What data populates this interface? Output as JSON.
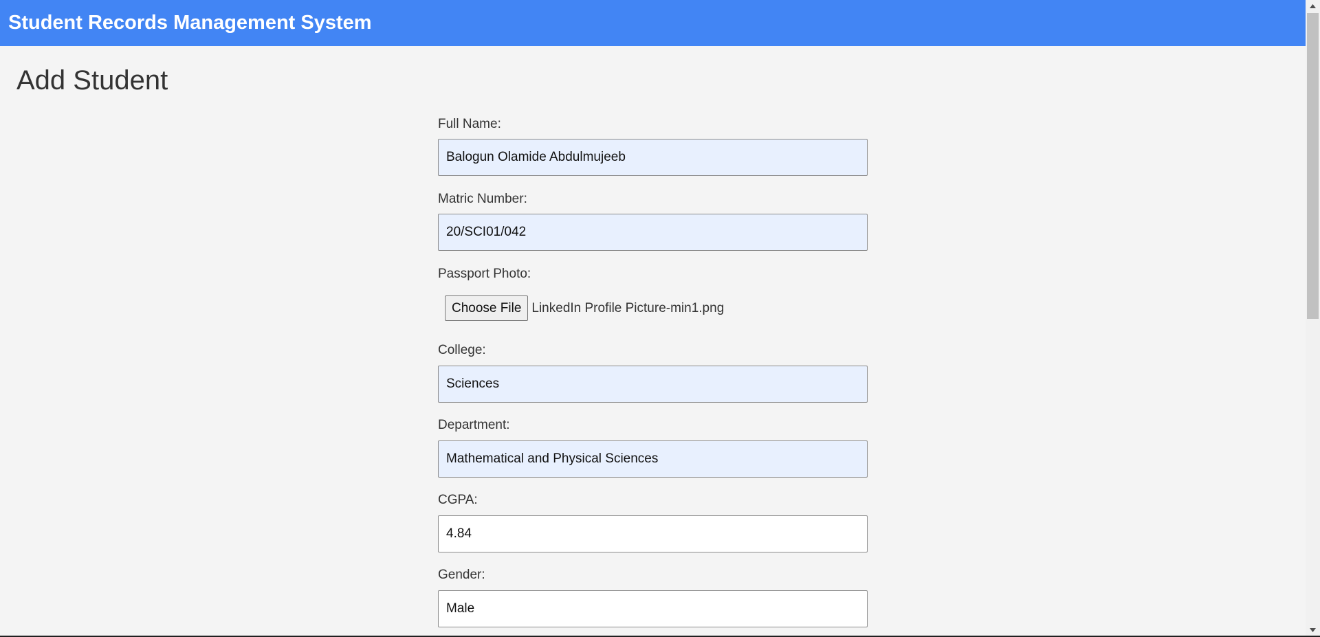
{
  "header": {
    "title": "Student Records Management System"
  },
  "page": {
    "heading": "Add Student"
  },
  "form": {
    "full_name": {
      "label": "Full Name:",
      "value": "Balogun Olamide Abdulmujeeb"
    },
    "matric_number": {
      "label": "Matric Number:",
      "value": "20/SCI01/042"
    },
    "passport_photo": {
      "label": "Passport Photo:",
      "button_label": "Choose File",
      "file_name": "LinkedIn Profile Picture-min1.png"
    },
    "college": {
      "label": "College:",
      "value": "Sciences"
    },
    "department": {
      "label": "Department:",
      "value": "Mathematical and Physical Sciences"
    },
    "cgpa": {
      "label": "CGPA:",
      "value": "4.84"
    },
    "gender": {
      "label": "Gender:",
      "value": "Male"
    }
  },
  "scrollbar": {
    "up_icon": "triangle-up-icon",
    "down_icon": "triangle-down-icon"
  },
  "colors": {
    "header_background": "#4285f4",
    "page_background": "#f4f4f4",
    "autofill_background": "#e8f0fe",
    "input_border": "#8a8a8a"
  }
}
